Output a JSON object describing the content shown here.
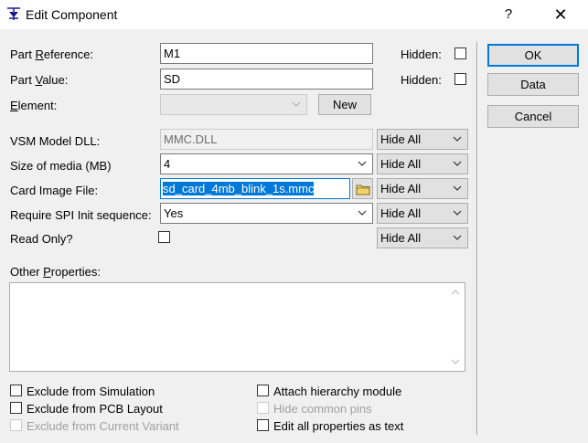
{
  "window": {
    "title": "Edit Component",
    "help_label": "?",
    "close_label": "✕"
  },
  "fields": {
    "part_reference": {
      "label_pre": "Part ",
      "label_ul": "R",
      "label_post": "eference:",
      "value": "M1",
      "hidden_label": "Hidden:"
    },
    "part_value": {
      "label_pre": "Part ",
      "label_ul": "V",
      "label_post": "alue:",
      "value": "SD",
      "hidden_label": "Hidden:"
    },
    "element": {
      "label_ul": "E",
      "label_post": "lement:",
      "value": "",
      "new_label": "New"
    }
  },
  "properties": [
    {
      "label": "VSM Model DLL:",
      "value": "MMC.DLL",
      "visibility": "Hide All"
    },
    {
      "label": "Size of media (MB)",
      "value": "4",
      "visibility": "Hide All"
    },
    {
      "label": "Card Image File:",
      "value": "sd_card_4mb_blink_1s.mmc",
      "visibility": "Hide All"
    },
    {
      "label": "Require SPI Init sequence:",
      "value": "Yes",
      "visibility": "Hide All"
    },
    {
      "label": "Read Only?",
      "visibility": "Hide All"
    }
  ],
  "other_properties": {
    "label_pre": "Other ",
    "label_ul": "P",
    "label_post": "roperties:",
    "text": ""
  },
  "checkboxes": {
    "exclude_simulation": "Exclude from Simulation",
    "exclude_pcb": "Exclude from PCB Layout",
    "exclude_variant": "Exclude from Current Variant",
    "attach_hierarchy": "Attach hierarchy module",
    "hide_common_pins": "Hide common pins",
    "edit_all_text": "Edit all properties as text"
  },
  "buttons": {
    "ok": "OK",
    "data": "Data",
    "cancel": "Cancel"
  }
}
